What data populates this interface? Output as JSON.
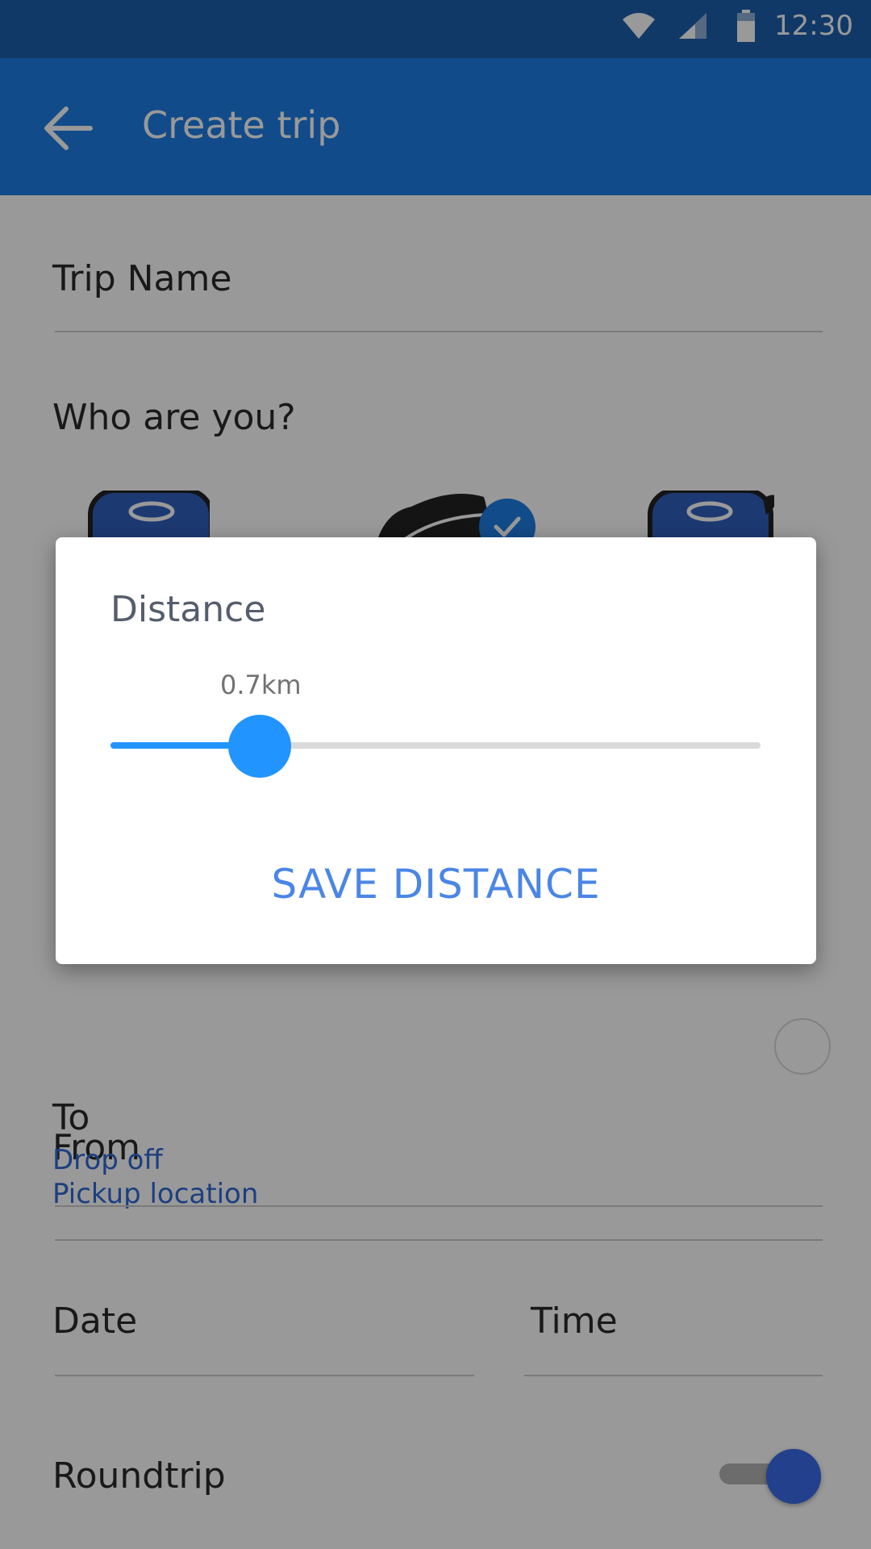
{
  "status_bar": {
    "time": "12:30",
    "icons": [
      "wifi-icon",
      "signal-icon",
      "battery-icon"
    ]
  },
  "app_bar": {
    "back_icon": "arrow-left-icon",
    "title": "Create trip"
  },
  "form": {
    "trip_name_label": "Trip Name",
    "who_label": "Who are you?",
    "from_label": "From",
    "from_value": "Pickup location",
    "to_label": "To",
    "to_value": "Drop off",
    "date_label": "Date",
    "time_label": "Time",
    "roundtrip_label": "Roundtrip",
    "roundtrip_on": true
  },
  "dialog": {
    "title": "Distance",
    "slider_value_text": "0.7km",
    "slider_fraction": 0.23,
    "save_label": "SAVE DISTANCE"
  },
  "colors": {
    "status_bar": "#1c5fae",
    "app_bar": "#1e7de5",
    "accent": "#2294ff",
    "link": "#2f6ad6",
    "button_text": "#4a86e6"
  }
}
